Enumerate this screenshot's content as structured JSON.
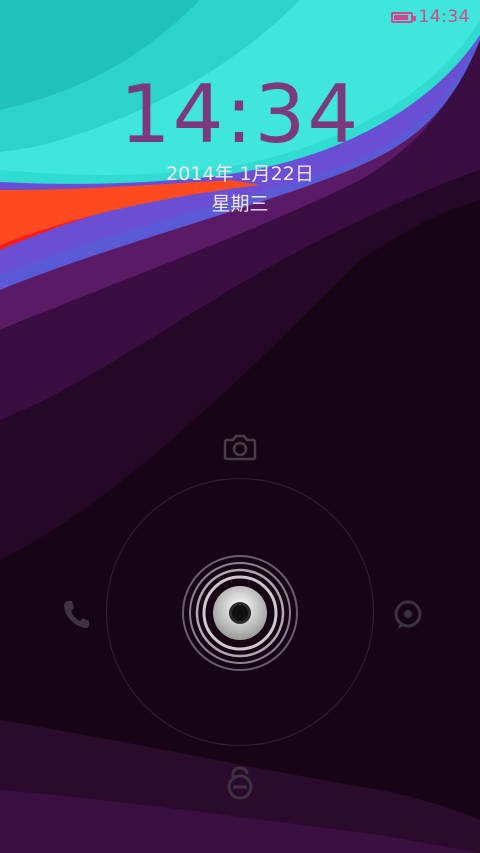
{
  "status_bar": {
    "time": "14:34",
    "battery_level": 0.9,
    "accent_color": "#d1488c"
  },
  "lockscreen": {
    "clock": "14:34",
    "date": "2014年 1月22日",
    "weekday": "星期三"
  },
  "shortcuts": [
    {
      "icon": "camera-icon"
    },
    {
      "icon": "phone-icon"
    },
    {
      "icon": "message-icon"
    },
    {
      "icon": "unlock-icon"
    }
  ],
  "colors": {
    "teal": "#30dbd2",
    "orange": "#ff4a1f",
    "blue": "#5a5ad6",
    "purple": "#5b1a66",
    "background": "#0d030b"
  }
}
